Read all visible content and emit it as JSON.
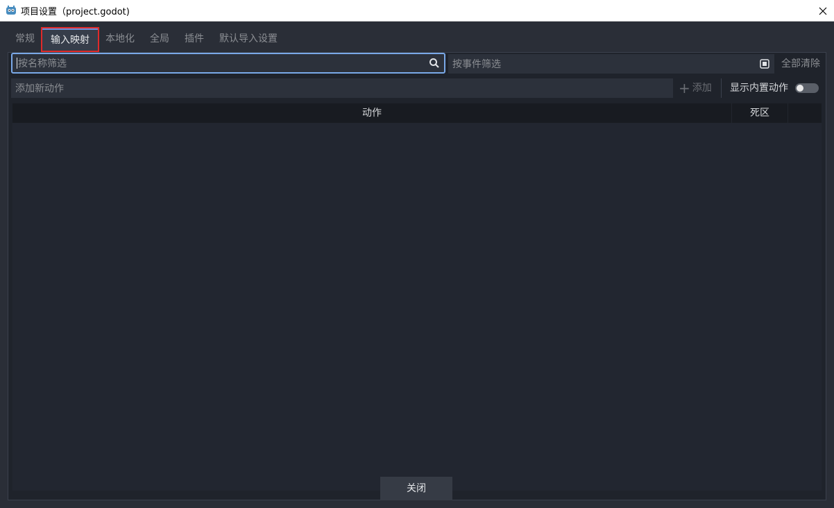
{
  "window": {
    "title": "项目设置（project.godot)",
    "close_icon": "close-icon"
  },
  "tabs": [
    {
      "label": "常规"
    },
    {
      "label": "输入映射"
    },
    {
      "label": "本地化"
    },
    {
      "label": "全局"
    },
    {
      "label": "插件"
    },
    {
      "label": "默认导入设置"
    }
  ],
  "filters": {
    "name_placeholder": "按名称筛选",
    "event_placeholder": "按事件筛选",
    "clear_all": "全部清除"
  },
  "actions_bar": {
    "new_action_placeholder": "添加新动作",
    "add_label": "添加",
    "show_builtin_label": "显示内置动作",
    "show_builtin_on": false
  },
  "table": {
    "col_action": "动作",
    "col_deadzone": "死区"
  },
  "footer": {
    "close_label": "关闭"
  },
  "colors": {
    "accent": "#7aa9e8",
    "highlight": "#e02a2a"
  }
}
